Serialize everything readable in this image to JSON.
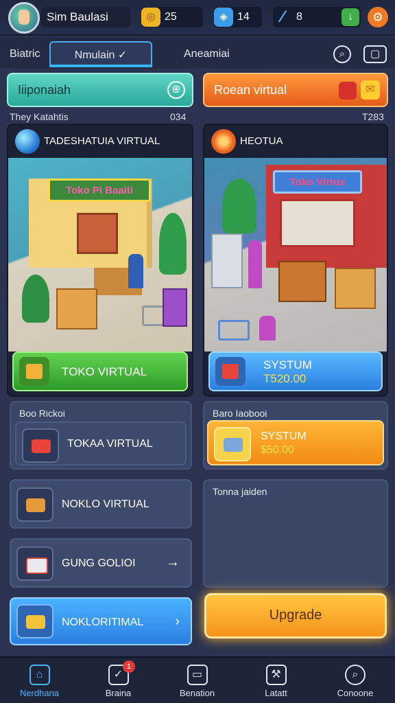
{
  "player": {
    "name": "Sim Baulasi"
  },
  "resources": {
    "coins": "25",
    "gems": "14",
    "energy": "8"
  },
  "tabs": [
    "Biatric",
    "Nmulain",
    "Aneamiai"
  ],
  "tab_icons": [
    "search-icon",
    "screen-icon"
  ],
  "panel_buttons": {
    "left": "Iiiponaiah",
    "right": "Roean virtual"
  },
  "subheaders": {
    "left_label": "They Katahtis",
    "left_value": "034",
    "right_value": "T283"
  },
  "cards": [
    {
      "title": "TADESHATUIA VIRTUAL",
      "shop_sign": "Toko Pi Baaiti",
      "footer": "TOKO VIRTUAL"
    },
    {
      "title": "HEOTUA",
      "shop_sign": "Toko Virtus",
      "footer_title": "SYSTUM",
      "footer_price": "T520.00"
    }
  ],
  "left_group": {
    "title": "Boo Rickoi",
    "item": "TOKAA VIRTUAL"
  },
  "right_group": {
    "title": "Baro Iaobooi",
    "item_title": "SYSTUM",
    "item_price": "$50.00"
  },
  "list_rows": [
    {
      "label": "NOKLO VIRTUAL"
    },
    {
      "label": "GUNG GOLIOI"
    },
    {
      "label": "NOKLORITIMAL"
    }
  ],
  "right_panel_title": "Tonna jaiden",
  "upgrade_label": "Upgrade",
  "bottom_nav": [
    {
      "label": "Nerdhana",
      "icon": "home-icon",
      "active": true
    },
    {
      "label": "Braina",
      "icon": "stats-icon",
      "badge": "1"
    },
    {
      "label": "Benation",
      "icon": "cards-icon"
    },
    {
      "label": "Latatt",
      "icon": "hammer-icon"
    },
    {
      "label": "Conoone",
      "icon": "search-icon"
    }
  ],
  "colors": {
    "background": "#2b3350",
    "accent_blue": "#47b4ff",
    "accent_orange": "#f7931b",
    "accent_green": "#3fae49"
  }
}
